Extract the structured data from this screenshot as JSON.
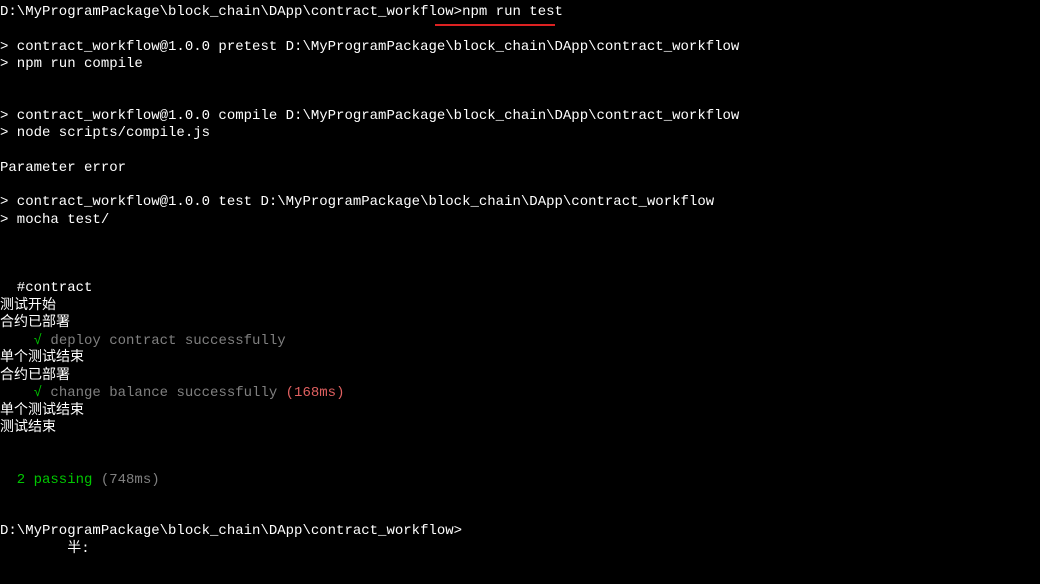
{
  "prompt1_path": "D:\\MyProgramPackage\\block_chain\\DApp\\contract_workflow>",
  "prompt1_cmd": "npm run test",
  "blank": "",
  "pretest_header": "> contract_workflow@1.0.0 pretest D:\\MyProgramPackage\\block_chain\\DApp\\contract_workflow",
  "pretest_cmd": "> npm run compile",
  "compile_header": "> contract_workflow@1.0.0 compile D:\\MyProgramPackage\\block_chain\\DApp\\contract_workflow",
  "compile_cmd": "> node scripts/compile.js",
  "param_error": "Parameter error",
  "test_header": "> contract_workflow@1.0.0 test D:\\MyProgramPackage\\block_chain\\DApp\\contract_workflow",
  "test_cmd": "> mocha test/",
  "contract_label": "  #contract",
  "test_start": "测试开始",
  "deployed1": "合约已部署",
  "check1": "    √",
  "deploy_msg": " deploy contract successfully",
  "single_end1": "单个测试结束",
  "deployed2": "合约已部署",
  "check2": "    √",
  "change_msg": " change balance successfully ",
  "change_time": "(168ms)",
  "single_end2": "单个测试结束",
  "test_end": "测试结束",
  "passing": "  2 passing ",
  "passing_time": "(748ms)",
  "prompt2": "D:\\MyProgramPackage\\block_chain\\DApp\\contract_workflow>",
  "ime_text": "        半:"
}
